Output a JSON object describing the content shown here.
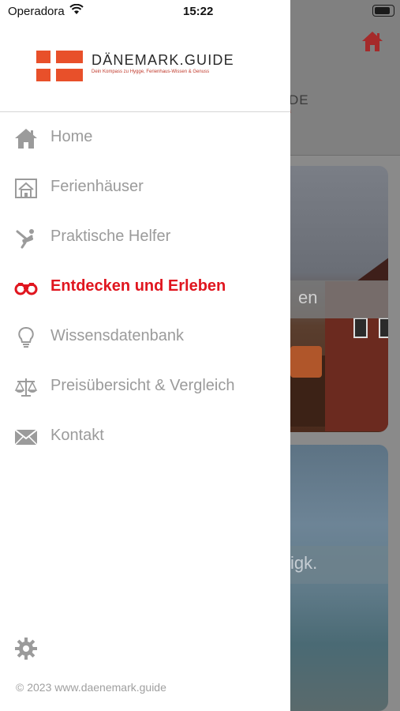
{
  "status_bar": {
    "carrier": "Operadora",
    "time": "15:22"
  },
  "logo": {
    "title": "DÄNEMARK.GUIDE",
    "subtitle": "Dein Kompass zu Hygge, Ferienhaus-Wissen & Genuss"
  },
  "menu": {
    "items": [
      {
        "label": "Home",
        "icon": "home-icon",
        "active": false
      },
      {
        "label": "Ferienhäuser",
        "icon": "house-icon",
        "active": false
      },
      {
        "label": "Praktische Helfer",
        "icon": "tools-icon",
        "active": false
      },
      {
        "label": "Entdecken und Erleben",
        "icon": "binoculars-icon",
        "active": true
      },
      {
        "label": "Wissensdatenbank",
        "icon": "lightbulb-icon",
        "active": false
      },
      {
        "label": "Preisübersicht & Vergleich",
        "icon": "scales-icon",
        "active": false
      },
      {
        "label": "Kontakt",
        "icon": "envelope-icon",
        "active": false
      }
    ]
  },
  "settings_icon": "gear-icon",
  "footer": "© 2023 www.daenemark.guide",
  "background": {
    "header_logo_fragment": "DE",
    "card1_label": "en",
    "card2_label": "igk."
  },
  "colors": {
    "accent": "#e0161f",
    "brand_flag": "#e8502a",
    "inactive": "#9b9b9b"
  }
}
